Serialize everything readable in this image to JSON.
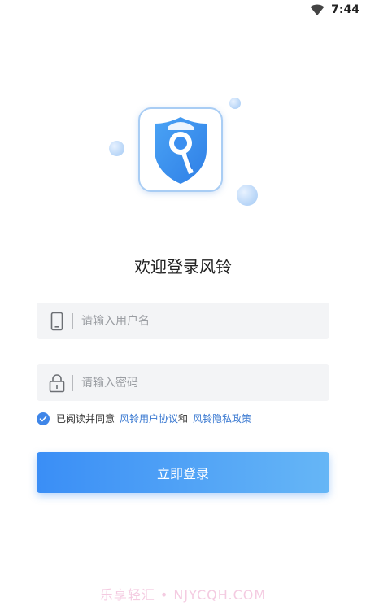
{
  "status_bar": {
    "time": "7:44",
    "wifi_icon": "wifi-icon"
  },
  "app": {
    "title": "欢迎登录风铃",
    "logo_icon": "shield-search-icon"
  },
  "form": {
    "username": {
      "placeholder": "请输入用户名",
      "value": "",
      "icon": "phone-icon"
    },
    "password": {
      "placeholder": "请输入密码",
      "value": "",
      "icon": "lock-icon"
    }
  },
  "agreement": {
    "checked": true,
    "prefix": "已阅读并同意",
    "user_agreement": "风铃用户协议",
    "joiner": "和",
    "privacy_policy": "风铃隐私政策"
  },
  "login_button": {
    "label": "立即登录"
  },
  "watermark": {
    "text": "乐享轻汇 • NJYCQH.COM"
  },
  "colors": {
    "primary": "#3a8ef6",
    "primary_light": "#66b6f6",
    "link": "#3a79d1",
    "field_bg": "#f3f4f6"
  }
}
